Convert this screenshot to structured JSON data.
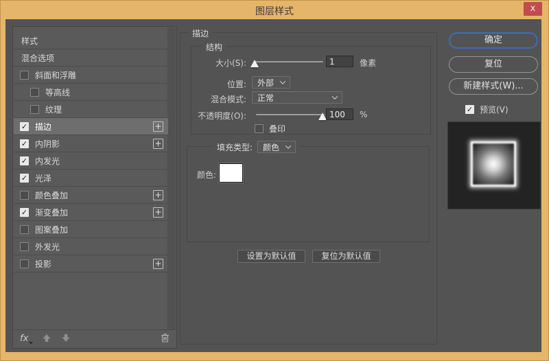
{
  "window": {
    "title": "图层样式",
    "close_glyph": "x"
  },
  "colors": {
    "titlebar": "#e5b669",
    "close_red": "#c14b4f",
    "dialog_bg": "#535353",
    "selected_row": "#6e6e6e",
    "ok_focus_ring": "#3f6cb5",
    "stroke_color_swatch": "#ffffff"
  },
  "sidebar": {
    "items": [
      {
        "label": "样式",
        "has_checkbox": false,
        "checked": false,
        "indent": false,
        "plus": false,
        "selected": false
      },
      {
        "label": "混合选项",
        "has_checkbox": false,
        "checked": false,
        "indent": false,
        "plus": false,
        "selected": false
      },
      {
        "label": "斜面和浮雕",
        "has_checkbox": true,
        "checked": false,
        "indent": false,
        "plus": false,
        "selected": false
      },
      {
        "label": "等高线",
        "has_checkbox": true,
        "checked": false,
        "indent": true,
        "plus": false,
        "selected": false
      },
      {
        "label": "纹理",
        "has_checkbox": true,
        "checked": false,
        "indent": true,
        "plus": false,
        "selected": false
      },
      {
        "label": "描边",
        "has_checkbox": true,
        "checked": true,
        "indent": false,
        "plus": true,
        "selected": true
      },
      {
        "label": "内阴影",
        "has_checkbox": true,
        "checked": true,
        "indent": false,
        "plus": true,
        "selected": false
      },
      {
        "label": "内发光",
        "has_checkbox": true,
        "checked": true,
        "indent": false,
        "plus": false,
        "selected": false
      },
      {
        "label": "光泽",
        "has_checkbox": true,
        "checked": true,
        "indent": false,
        "plus": false,
        "selected": false
      },
      {
        "label": "颜色叠加",
        "has_checkbox": true,
        "checked": false,
        "indent": false,
        "plus": true,
        "selected": false
      },
      {
        "label": "渐变叠加",
        "has_checkbox": true,
        "checked": true,
        "indent": false,
        "plus": true,
        "selected": false
      },
      {
        "label": "图案叠加",
        "has_checkbox": true,
        "checked": false,
        "indent": false,
        "plus": false,
        "selected": false
      },
      {
        "label": "外发光",
        "has_checkbox": true,
        "checked": false,
        "indent": false,
        "plus": false,
        "selected": false
      },
      {
        "label": "投影",
        "has_checkbox": true,
        "checked": false,
        "indent": false,
        "plus": true,
        "selected": false
      }
    ],
    "footer": {
      "fx_label": "fx",
      "check_glyph": "✓",
      "plus_glyph": "+"
    }
  },
  "main": {
    "group_title": "描边",
    "structure": {
      "title": "结构",
      "size_label": "大小(S):",
      "size_value": "1",
      "size_unit": "像素",
      "size_slider_fraction": 0.02,
      "position_label": "位置:",
      "position_value": "外部",
      "blend_label": "混合模式:",
      "blend_value": "正常",
      "opacity_label": "不透明度(O):",
      "opacity_value": "100",
      "opacity_unit": "%",
      "opacity_slider_fraction": 0.97,
      "overprint_label": "叠印",
      "overprint_checked": false
    },
    "fill": {
      "type_label": "填充类型:",
      "type_value": "颜色",
      "color_label": "颜色:",
      "color_value": "#ffffff"
    },
    "buttons": {
      "make_default": "设置为默认值",
      "reset_default": "复位为默认值"
    }
  },
  "actions": {
    "ok": "确定",
    "reset": "复位",
    "new_style": "新建样式(W)...",
    "preview_label": "预览(V)",
    "preview_checked": true
  }
}
